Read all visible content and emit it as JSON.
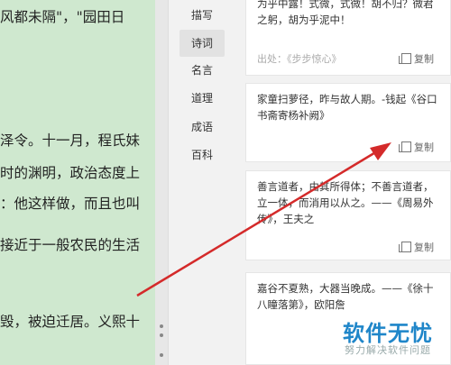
{
  "reader": {
    "lines": [
      "风都未隔\"，\"园田日",
      "泽令。十一月，程氏妹",
      "时的渊明，政治态度上",
      "：他这样做，而且也叫",
      "接近于一般农民的生活",
      "毁，被迫迁居。义熙十"
    ]
  },
  "nav": {
    "items": [
      "描写",
      "诗词",
      "名言",
      "道理",
      "成语",
      "百科"
    ],
    "active_index": 1
  },
  "cards": [
    {
      "text": "为乎中露！式微，式微！胡不归？微君之躬，胡为乎泥中！",
      "source": "出处：《步步惊心》",
      "copy_label": "复制"
    },
    {
      "text": "家童扫萝径，昨与故人期。-钱起《谷口书斋寄杨补阙》",
      "copy_label": "复制"
    },
    {
      "text": "善言道者，由其所得体；不善言道者，立一体，而消用以从之。——《周易外传》，王夫之",
      "copy_label": "复制"
    },
    {
      "text": "嘉谷不夏熟，大器当晚成。——《徐十八瞳落第》，欧阳詹"
    }
  ],
  "watermark": {
    "title": "软件无忧",
    "subtitle": "努力解决软件问题"
  },
  "colors": {
    "reader_bg": "#cfe8cf",
    "arrow": "#d42a2a",
    "watermark": "#1f86c9"
  }
}
